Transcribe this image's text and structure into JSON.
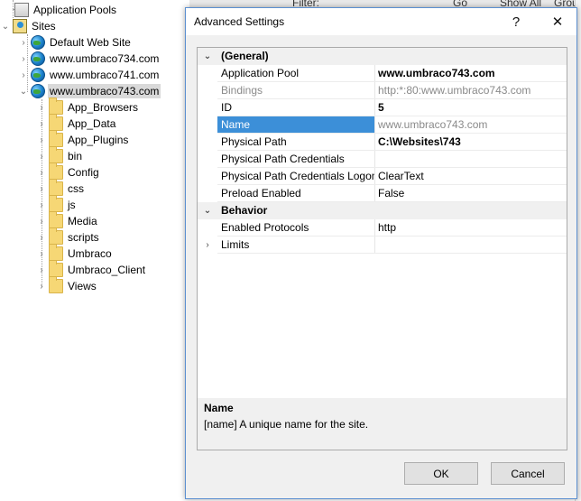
{
  "tree": {
    "app_pools": "Application Pools",
    "sites": "Sites",
    "site_items": [
      "Default Web Site",
      "www.umbraco734.com",
      "www.umbraco741.com",
      "www.umbraco743.com"
    ],
    "folders": [
      "App_Browsers",
      "App_Data",
      "App_Plugins",
      "bin",
      "Config",
      "css",
      "js",
      "Media",
      "scripts",
      "Umbraco",
      "Umbraco_Client",
      "Views"
    ]
  },
  "background": {
    "filter_label": "Filter:",
    "go_label": "Go",
    "show_all_label": "Show All",
    "group_label": "Grou"
  },
  "dialog": {
    "title": "Advanced Settings",
    "help": "?",
    "close": "✕",
    "categories": {
      "general": "(General)",
      "behavior": "Behavior"
    },
    "properties": {
      "app_pool_name": "Application Pool",
      "app_pool_value": "www.umbraco743.com",
      "bindings_name": "Bindings",
      "bindings_value": "http:*:80:www.umbraco743.com",
      "id_name": "ID",
      "id_value": "5",
      "name_name": "Name",
      "name_value": "www.umbraco743.com",
      "path_name": "Physical Path",
      "path_value": "C:\\Websites\\743",
      "creds_name": "Physical Path Credentials",
      "creds_value": "",
      "logon_name": "Physical Path Credentials Logon",
      "logon_value": "ClearText",
      "preload_name": "Preload Enabled",
      "preload_value": "False",
      "protocols_name": "Enabled Protocols",
      "protocols_value": "http",
      "limits_name": "Limits",
      "limits_value": ""
    },
    "description": {
      "title": "Name",
      "text": "[name] A unique name for the site."
    },
    "ok_label": "OK",
    "cancel_label": "Cancel"
  },
  "colors": {
    "selection": "#3c8fd8",
    "dialog_border": "#5b8fd0",
    "tree_selection": "#d9d9d9"
  }
}
